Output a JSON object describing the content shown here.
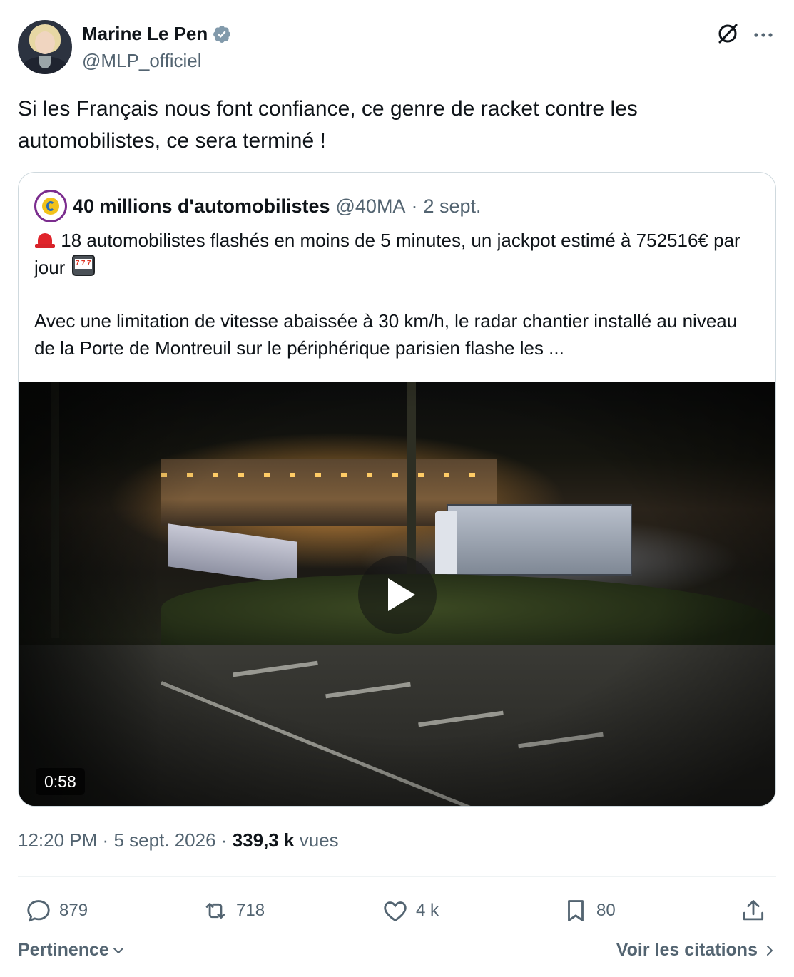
{
  "author": {
    "name": "Marine Le Pen",
    "handle": "@MLP_officiel",
    "verified_icon": "verified-badge-icon"
  },
  "tweet": {
    "text": "Si les Français nous font confiance, ce genre de racket contre les automobilistes, ce sera terminé !",
    "time": "12:20 PM",
    "date": "5 sept. 2026",
    "views_count": "339,3 k",
    "views_label": "vues",
    "separator": "·"
  },
  "quote": {
    "name": "40 millions d'automobilistes",
    "handle": "@40MA",
    "date": "2 sept.",
    "separator": "·",
    "line1": "18 automobilistes flashés en moins de 5 minutes, un jackpot estimé à 752516€ par jour",
    "line2": "Avec une limitation de vitesse abaissée à 30 km/h, le radar chantier installé au niveau de la Porte de Montreuil sur le périphérique parisien flashe les ...",
    "video_duration": "0:58"
  },
  "actions": {
    "replies": "879",
    "retweets": "718",
    "likes": "4 k",
    "bookmarks": "80"
  },
  "footer": {
    "sort_label": "Pertinence",
    "quotes_label": "Voir les citations"
  },
  "colors": {
    "text": "#0f1419",
    "secondary": "#536471",
    "border": "#cfd9de",
    "verified": "#829aab"
  }
}
